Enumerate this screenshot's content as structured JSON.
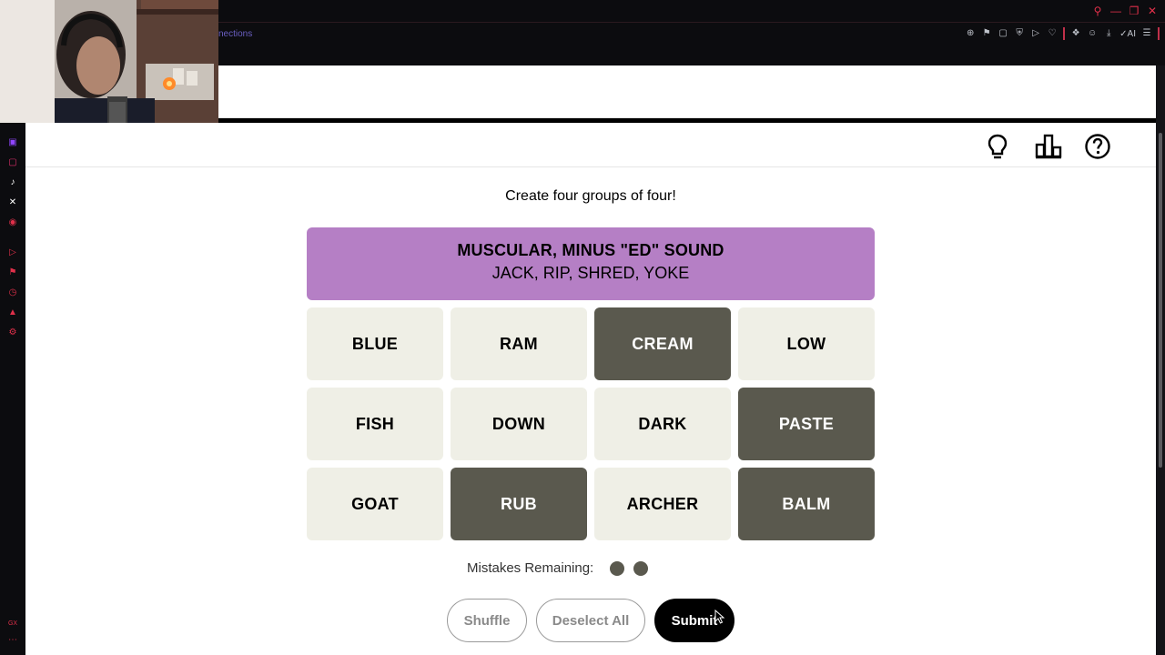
{
  "browser": {
    "tab_title": "nections",
    "window_controls": [
      "search-icon",
      "minimize-icon",
      "restore-icon",
      "close-icon"
    ],
    "toolbar_icons": [
      "zoom-icon",
      "bookmark-icon",
      "snapshot-icon",
      "shield-icon",
      "play-icon",
      "heart-icon",
      "extensions-icon",
      "account-icon",
      "download-icon",
      "ai-icon",
      "menu-icon"
    ],
    "ai_label": "AI"
  },
  "sidebar": {
    "items": [
      {
        "icon": "twitch-icon",
        "color": "#9146ff"
      },
      {
        "icon": "instagram-icon",
        "color": "#e1306c"
      },
      {
        "icon": "tiktok-icon",
        "color": "#ffffff"
      },
      {
        "icon": "x-icon",
        "color": "#ffffff"
      },
      {
        "icon": "record-icon",
        "color": "#e0304a"
      },
      {
        "icon": "play-circle-icon",
        "color": "#e0304a"
      },
      {
        "icon": "pin-icon",
        "color": "#e0304a"
      },
      {
        "icon": "history-icon",
        "color": "#e0304a"
      },
      {
        "icon": "extensions-icon",
        "color": "#e0304a"
      },
      {
        "icon": "settings-icon",
        "color": "#e0304a"
      }
    ],
    "bottom_label": "GX"
  },
  "game": {
    "header_icons": [
      "lightbulb-icon",
      "leaderboard-icon",
      "help-icon"
    ],
    "instructions": "Create four groups of four!",
    "solved_group": {
      "title": "MUSCULAR, MINUS \"ED\" SOUND",
      "members": "JACK, RIP, SHRED, YOKE",
      "color": "#b57fc5"
    },
    "tiles": [
      {
        "word": "BLUE",
        "selected": false
      },
      {
        "word": "RAM",
        "selected": false
      },
      {
        "word": "CREAM",
        "selected": true
      },
      {
        "word": "LOW",
        "selected": false
      },
      {
        "word": "FISH",
        "selected": false
      },
      {
        "word": "DOWN",
        "selected": false
      },
      {
        "word": "DARK",
        "selected": false
      },
      {
        "word": "PASTE",
        "selected": true
      },
      {
        "word": "GOAT",
        "selected": false
      },
      {
        "word": "RUB",
        "selected": true
      },
      {
        "word": "ARCHER",
        "selected": false
      },
      {
        "word": "BALM",
        "selected": true
      }
    ],
    "mistakes_label": "Mistakes Remaining:",
    "mistakes_remaining": 2,
    "buttons": {
      "shuffle": "Shuffle",
      "deselect_all": "Deselect All",
      "submit": "Submit"
    },
    "colors": {
      "tile": "#efefe6",
      "tile_selected": "#5a594e"
    }
  }
}
